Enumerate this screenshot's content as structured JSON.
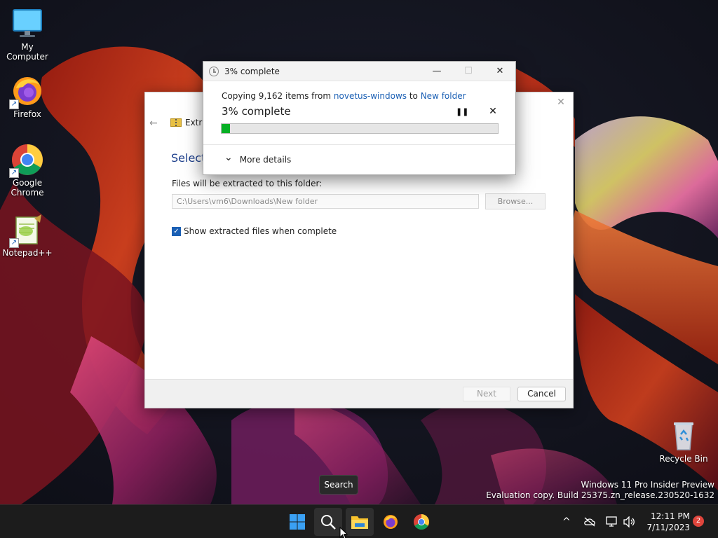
{
  "desktop": {
    "icons": [
      {
        "label": "My Computer",
        "icon": "monitor-icon"
      },
      {
        "label": "Firefox",
        "icon": "firefox-icon"
      },
      {
        "label": "Google Chrome",
        "icon": "chrome-icon"
      },
      {
        "label": "Notepad++",
        "icon": "notepadpp-icon"
      }
    ],
    "recycle_bin": {
      "label": "Recycle Bin",
      "icon": "recycle-bin-icon"
    },
    "watermark": {
      "line1": "Windows 11 Pro Insider Preview",
      "line2": "Evaluation copy. Build 25375.zn_release.230520-1632"
    }
  },
  "extract_wizard": {
    "title": "Extra",
    "heading": "Select",
    "destination_label": "Files will be extracted to this folder:",
    "destination_value": "C:\\Users\\vm6\\Downloads\\New folder",
    "browse_label": "Browse...",
    "show_files_label": "Show extracted files when complete",
    "show_files_checked": true,
    "next_label": "Next",
    "cancel_label": "Cancel"
  },
  "progress_dialog": {
    "title": "3% complete",
    "copy_prefix": "Copying 9,162 items from ",
    "source": "novetus-windows",
    "to_word": " to ",
    "destination": "New folder",
    "percent_text": "3% complete",
    "progress_percent": 3,
    "more_details_label": "More details",
    "minimize_glyph": "—",
    "maximize_glyph": "☐",
    "close_glyph": "✕",
    "pause_glyph": "❚❚",
    "stop_glyph": "✕",
    "chevron_glyph": "⌄",
    "progress_color": "#06b025"
  },
  "taskbar": {
    "tooltip": "Search",
    "apps": [
      "start-icon",
      "search-icon",
      "file-explorer-icon",
      "firefox-icon",
      "chrome-icon"
    ],
    "time": "12:11 PM",
    "date": "7/11/2023",
    "notifications": "2",
    "chevron_glyph": "^"
  }
}
